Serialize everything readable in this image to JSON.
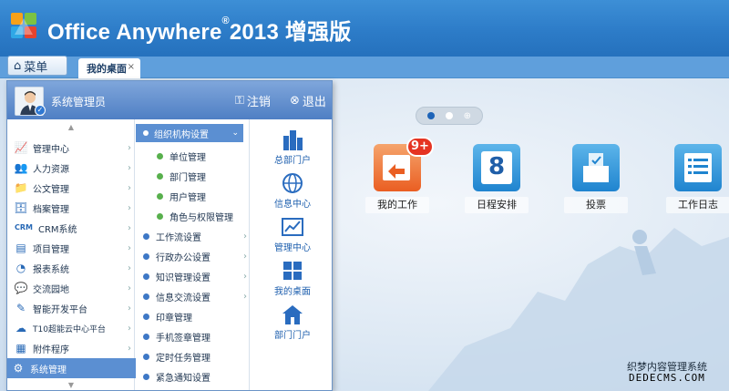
{
  "app": {
    "title": "Office Anywhere",
    "registered": "®",
    "edition": "2013 增强版"
  },
  "topbar": {
    "menu_label": "菜单",
    "tab_label": "我的桌面",
    "tab_close": "×"
  },
  "user": {
    "name": "系统管理员",
    "logout": "注销",
    "exit": "退出"
  },
  "main_menu": {
    "items": [
      {
        "label": "管理中心",
        "icon": "chart-icon"
      },
      {
        "label": "人力资源",
        "icon": "people-icon"
      },
      {
        "label": "公文管理",
        "icon": "folder-icon"
      },
      {
        "label": "档案管理",
        "icon": "archive-icon"
      },
      {
        "label": "CRM系统",
        "icon": "crm-icon"
      },
      {
        "label": "项目管理",
        "icon": "project-icon"
      },
      {
        "label": "报表系统",
        "icon": "pie-icon"
      },
      {
        "label": "交流园地",
        "icon": "chat-icon"
      },
      {
        "label": "智能开发平台",
        "icon": "dev-icon"
      },
      {
        "label": "T10超能云中心平台",
        "icon": "cloud-icon"
      },
      {
        "label": "附件程序",
        "icon": "attachment-icon"
      },
      {
        "label": "系统管理",
        "icon": "gear-icon"
      }
    ]
  },
  "sub_menu": {
    "header": "组织机构设置",
    "sub_items": [
      "单位管理",
      "部门管理",
      "用户管理",
      "角色与权限管理"
    ],
    "items": [
      {
        "label": "工作流设置",
        "arrow": true
      },
      {
        "label": "行政办公设置",
        "arrow": true
      },
      {
        "label": "知识管理设置",
        "arrow": true
      },
      {
        "label": "信息交流设置",
        "arrow": true
      },
      {
        "label": "印章管理",
        "arrow": false
      },
      {
        "label": "手机签章管理",
        "arrow": false
      },
      {
        "label": "定时任务管理",
        "arrow": false
      },
      {
        "label": "紧急通知设置",
        "arrow": false
      }
    ]
  },
  "quick_links": [
    "总部门户",
    "信息中心",
    "管理中心",
    "我的桌面",
    "部门门户"
  ],
  "desktop": {
    "icons": [
      {
        "label": "我的工作",
        "badge": "9+"
      },
      {
        "label": "日程安排",
        "number": "8"
      },
      {
        "label": "投票"
      },
      {
        "label": "工作日志"
      }
    ]
  },
  "watermark": {
    "line1": "织梦内容管理系统",
    "line2": "DEDECMS.COM"
  },
  "colors": {
    "header": "#2d7cc8",
    "menu_selected": "#5b8fd2",
    "tile_orange": "#ec6a2c",
    "tile_blue": "#2a8fd6"
  }
}
